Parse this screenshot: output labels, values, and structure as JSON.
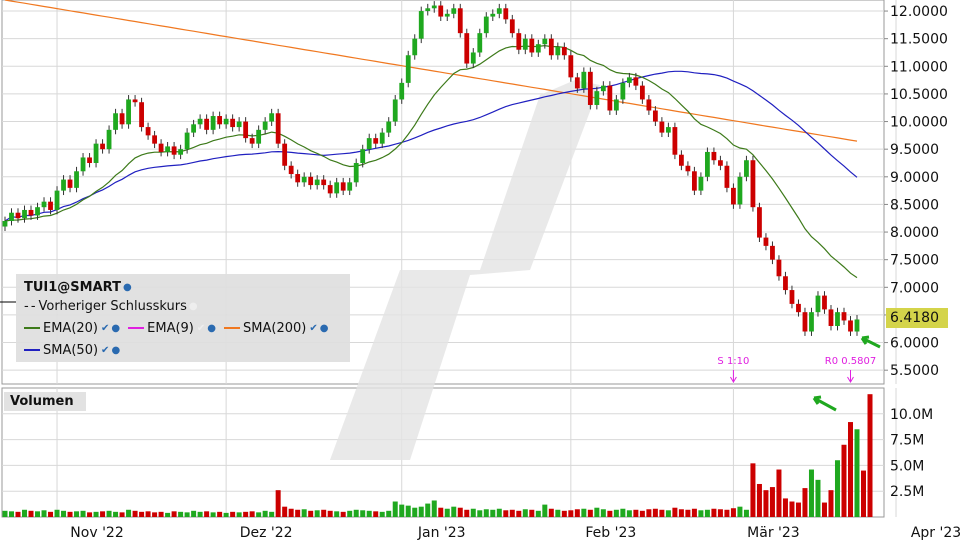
{
  "chart_data": {
    "type": "candlestick",
    "title": "TUI1@SMART",
    "price_axis": {
      "ticks": [
        "12.0000",
        "11.5000",
        "11.0000",
        "10.5000",
        "10.0000",
        "9.5000",
        "9.0000",
        "8.5000",
        "8.0000",
        "7.5000",
        "7.0000",
        "6.5000",
        "6.0000",
        "5.5000"
      ],
      "ylim": [
        5.25,
        12.2
      ]
    },
    "volume_axis": {
      "ticks": [
        "10.0M",
        "7.5M",
        "5.0M",
        "2.5M"
      ],
      "ylim": [
        0,
        12500000
      ]
    },
    "x_labels": [
      "Nov '22",
      "Dez '22",
      "Jan '23",
      "Feb '23",
      "Mär '23",
      "Apr '23"
    ],
    "legend": {
      "symbol": "TUI1@SMART",
      "prev_close": "Vorheriger Schlusskurs",
      "ema20": "EMA(20)",
      "ema9": "EMA(9)",
      "sma200": "SMA(200)",
      "sma50": "SMA(50)"
    },
    "colors": {
      "up": "#1fa81f",
      "down": "#cc0000",
      "ema20": "#3d7a1a",
      "ema9": "#e020e0",
      "sma200": "#f07820",
      "sma50": "#2020c0",
      "price_badge": "#d4d44a"
    },
    "volume_label": "Volumen",
    "last_price": "6.4180",
    "annotations": [
      "S 1:10",
      "R0 0.5807"
    ],
    "closes": [
      8.2,
      8.35,
      8.25,
      8.4,
      8.3,
      8.45,
      8.55,
      8.4,
      8.75,
      8.95,
      8.8,
      9.1,
      9.35,
      9.25,
      9.6,
      9.5,
      9.85,
      10.15,
      9.95,
      10.4,
      10.35,
      9.9,
      9.75,
      9.6,
      9.45,
      9.55,
      9.4,
      9.5,
      9.8,
      9.95,
      10.05,
      9.85,
      10.1,
      9.95,
      10.05,
      9.9,
      10.0,
      9.7,
      9.6,
      9.85,
      10.0,
      10.15,
      9.6,
      9.2,
      9.05,
      8.9,
      9.0,
      8.85,
      8.95,
      8.85,
      8.7,
      8.9,
      8.75,
      8.9,
      9.25,
      9.5,
      9.7,
      9.6,
      9.8,
      10.0,
      10.4,
      10.7,
      11.2,
      11.5,
      12.0,
      12.05,
      12.1,
      11.9,
      11.95,
      12.05,
      11.6,
      11.05,
      11.25,
      11.6,
      11.9,
      11.95,
      12.05,
      11.85,
      11.6,
      11.3,
      11.5,
      11.25,
      11.4,
      11.5,
      11.2,
      11.35,
      11.2,
      10.8,
      10.6,
      10.9,
      10.3,
      10.55,
      10.65,
      10.2,
      10.4,
      10.7,
      10.8,
      10.65,
      10.4,
      10.2,
      10.0,
      9.8,
      9.9,
      9.4,
      9.2,
      9.1,
      8.75,
      9.0,
      9.45,
      9.3,
      9.2,
      8.8,
      8.5,
      9.0,
      9.3,
      8.45,
      7.9,
      7.75,
      7.5,
      7.2,
      6.95,
      6.7,
      6.55,
      6.2,
      6.55,
      6.85,
      6.6,
      6.3,
      6.55,
      6.4,
      6.2,
      6.418
    ],
    "volumes": [
      600000,
      550000,
      500000,
      700000,
      600000,
      550000,
      650000,
      500000,
      700000,
      600000,
      500000,
      550000,
      600000,
      450000,
      500000,
      550000,
      600000,
      500000,
      450000,
      700000,
      600000,
      500000,
      550000,
      450000,
      500000,
      400000,
      550000,
      500000,
      450000,
      600000,
      500000,
      550000,
      450000,
      500000,
      400000,
      500000,
      450000,
      500000,
      550000,
      450000,
      600000,
      500000,
      2600000,
      1000000,
      800000,
      700000,
      750000,
      600000,
      650000,
      700000,
      600000,
      550000,
      500000,
      600000,
      700000,
      650000,
      600000,
      550000,
      500000,
      600000,
      1500000,
      1200000,
      1100000,
      900000,
      1000000,
      1300000,
      1600000,
      900000,
      800000,
      1000000,
      900000,
      700000,
      800000,
      650000,
      750000,
      700000,
      800000,
      650000,
      700000,
      600000,
      750000,
      700000,
      600000,
      1200000,
      800000,
      700000,
      600000,
      650000,
      750000,
      800000,
      700000,
      900000,
      750000,
      600000,
      700000,
      800000,
      650000,
      700000,
      600000,
      750000,
      800000,
      700000,
      650000,
      900000,
      750000,
      700000,
      800000,
      650000,
      700000,
      800000,
      750000,
      700000,
      850000,
      1000000,
      700000,
      5200000,
      3200000,
      2600000,
      2900000,
      4600000,
      1800000,
      1500000,
      1400000,
      2800000,
      4600000,
      3600000,
      1400000,
      2600000,
      5500000,
      7000000,
      9200000,
      8500000,
      4500000,
      11900000
    ]
  }
}
